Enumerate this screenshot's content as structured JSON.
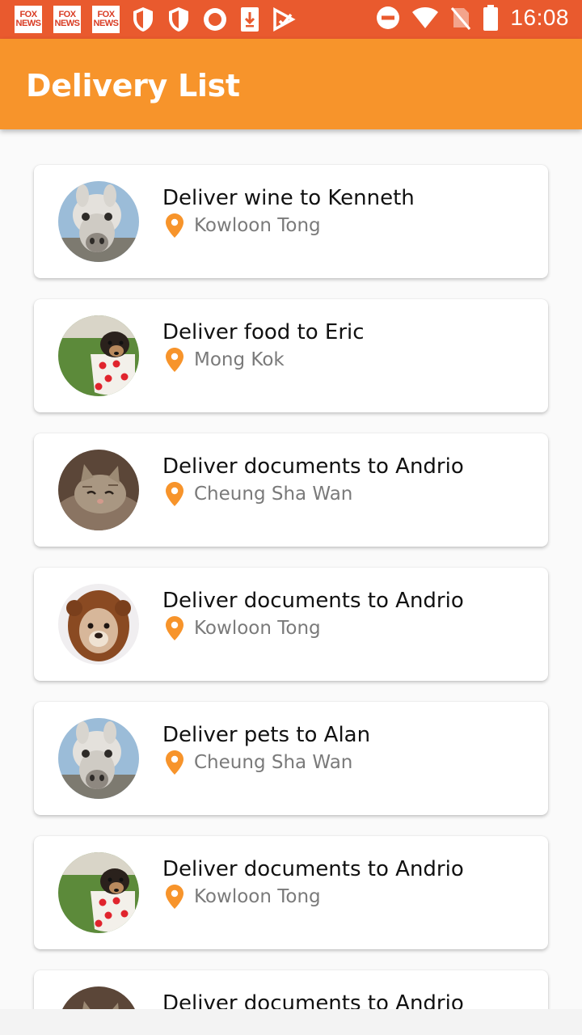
{
  "status_bar": {
    "time": "16:08",
    "notification_icons": [
      "fox-news-icon",
      "fox-news-icon",
      "fox-news-icon",
      "shield-icon",
      "shield-icon",
      "record-icon",
      "download-icon",
      "play-store-icon"
    ],
    "fox_label_top": "FOX",
    "fox_label_bottom": "NEWS",
    "system_icons": [
      "do-not-disturb-icon",
      "wifi-icon",
      "no-sim-icon",
      "battery-icon"
    ]
  },
  "app_bar": {
    "title": "Delivery List"
  },
  "colors": {
    "status_bar": "#e95a2e",
    "app_bar": "#f7942b",
    "pin": "#f7942b"
  },
  "deliveries": [
    {
      "title": "Deliver wine to Kenneth",
      "location": "Kowloon Tong",
      "avatar": "alpaca"
    },
    {
      "title": "Deliver food to Eric",
      "location": "Mong Kok",
      "avatar": "puppy-in-cup"
    },
    {
      "title": "Deliver documents to Andrio",
      "location": "Cheung Sha Wan",
      "avatar": "sleeping-cat"
    },
    {
      "title": "Deliver documents to Andrio",
      "location": "Kowloon Tong",
      "avatar": "dog-in-lion-hood"
    },
    {
      "title": "Deliver pets to Alan",
      "location": "Cheung Sha Wan",
      "avatar": "alpaca"
    },
    {
      "title": "Deliver documents to Andrio",
      "location": "Kowloon Tong",
      "avatar": "puppy-in-cup"
    },
    {
      "title": "Deliver documents to Andrio",
      "location": "",
      "avatar": "sleeping-cat"
    }
  ]
}
